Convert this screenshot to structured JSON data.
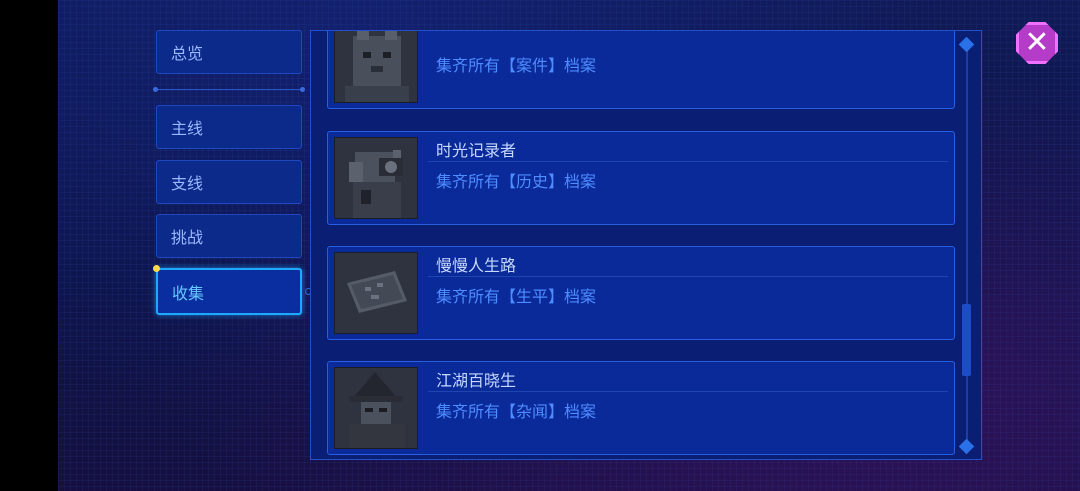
{
  "nav": {
    "items": [
      {
        "label": "总览"
      },
      {
        "label": "主线"
      },
      {
        "label": "支线"
      },
      {
        "label": "挑战"
      },
      {
        "label": "收集"
      }
    ],
    "active_index": 4
  },
  "close": {
    "glyph": "✕",
    "icon": "close-icon"
  },
  "achievements": [
    {
      "title": "",
      "description": "集齐所有【案件】档案",
      "thumb_icon": "cat-portrait-icon"
    },
    {
      "title": "时光记录者",
      "description": "集齐所有【历史】档案",
      "thumb_icon": "camera-photographer-icon"
    },
    {
      "title": "慢慢人生路",
      "description": "集齐所有【生平】档案",
      "thumb_icon": "map-scroll-icon"
    },
    {
      "title": "江湖百晓生",
      "description": "集齐所有【杂闻】档案",
      "thumb_icon": "hooded-figure-icon"
    }
  ],
  "colors": {
    "accent": "#1ea8ff",
    "close_button": "#b43cc8",
    "description_text": "#4e8cff"
  }
}
